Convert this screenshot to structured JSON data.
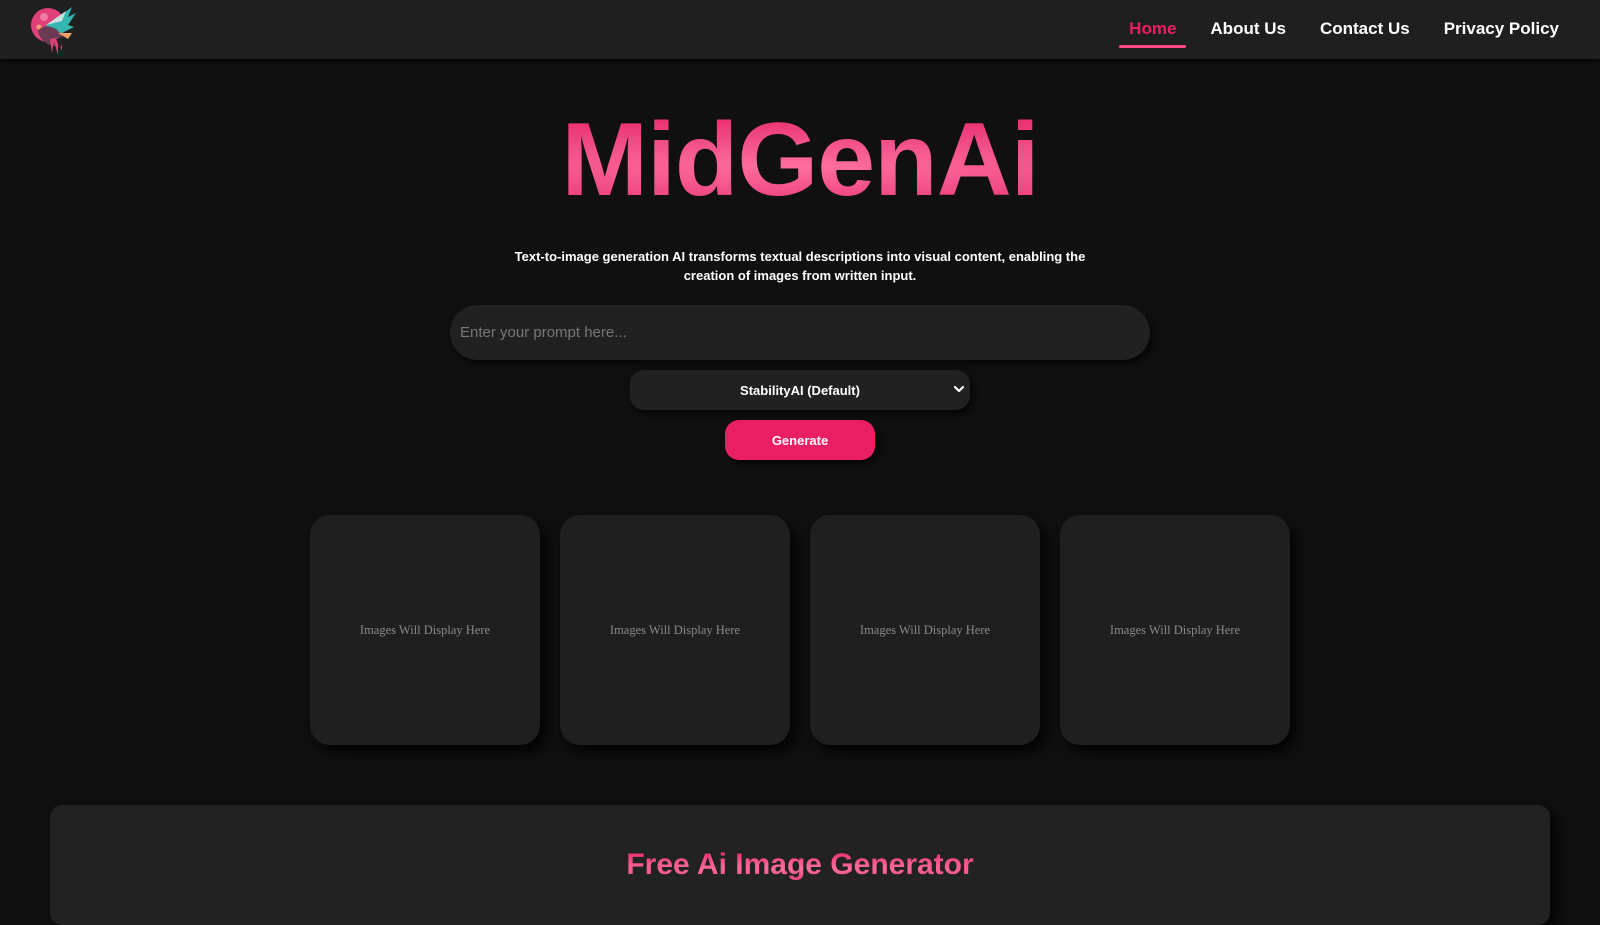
{
  "brand": {
    "logo_icon": "phoenix-bird-head-icon",
    "accent_color": "#e91e63",
    "background_color": "#101010",
    "surface_color": "#1f1f1f"
  },
  "nav": {
    "items": [
      {
        "label": "Home",
        "active": true
      },
      {
        "label": "About Us",
        "active": false
      },
      {
        "label": "Contact Us",
        "active": false
      },
      {
        "label": "Privacy Policy",
        "active": false
      }
    ]
  },
  "hero": {
    "title": "MidGenAi",
    "description": "Text-to-image generation AI transforms textual descriptions into visual content, enabling the creation of images from written input."
  },
  "form": {
    "prompt_value": "",
    "prompt_placeholder": "Enter your prompt here...",
    "model_selected": "StabilityAI (Default)",
    "model_icon": "chevron-down-icon",
    "generate_label": "Generate"
  },
  "gallery": {
    "cards": [
      {
        "placeholder": "Images Will Display Here"
      },
      {
        "placeholder": "Images Will Display Here"
      },
      {
        "placeholder": "Images Will Display Here"
      },
      {
        "placeholder": "Images Will Display Here"
      }
    ]
  },
  "info": {
    "title": "Free Ai Image Generator"
  }
}
